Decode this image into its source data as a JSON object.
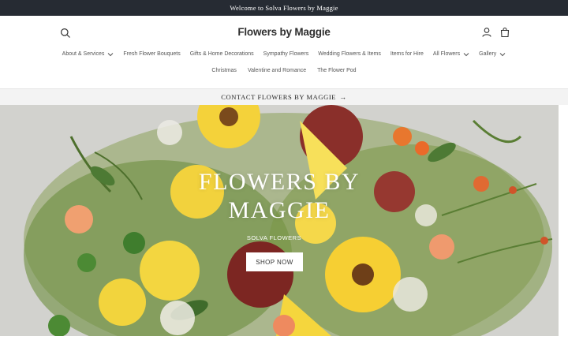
{
  "announcement": "Welcome to Solva Flowers by Maggie",
  "header": {
    "logo": "Flowers by Maggie",
    "icons": [
      "search-icon",
      "account-icon",
      "cart-icon"
    ]
  },
  "nav": {
    "row1": [
      {
        "label": "About & Services",
        "dropdown": true
      },
      {
        "label": "Fresh Flower Bouquets",
        "dropdown": false
      },
      {
        "label": "Gifts & Home Decorations",
        "dropdown": false
      },
      {
        "label": "Sympathy Flowers",
        "dropdown": false
      },
      {
        "label": "Wedding Flowers & Items",
        "dropdown": false
      },
      {
        "label": "Items for Hire",
        "dropdown": false
      },
      {
        "label": "All Flowers",
        "dropdown": true
      },
      {
        "label": "Gallery",
        "dropdown": true
      }
    ],
    "row2": [
      {
        "label": "Christmas"
      },
      {
        "label": "Valentine and Romance"
      },
      {
        "label": "The Flower Pod"
      }
    ]
  },
  "contact_bar": {
    "label": "CONTACT FLOWERS BY MAGGIE",
    "arrow": "→"
  },
  "hero": {
    "title_line1": "FLOWERS BY",
    "title_line2": "MAGGIE",
    "subtitle": "SOLVA FLOWERS",
    "button": "SHOP NOW"
  },
  "colors": {
    "announcement_bg": "#262b33",
    "contact_bg": "#f3f3f3",
    "yellow": "#f4d23a",
    "orange": "#e8772e",
    "maroon": "#8a2f2a",
    "green": "#5d8a3a"
  }
}
